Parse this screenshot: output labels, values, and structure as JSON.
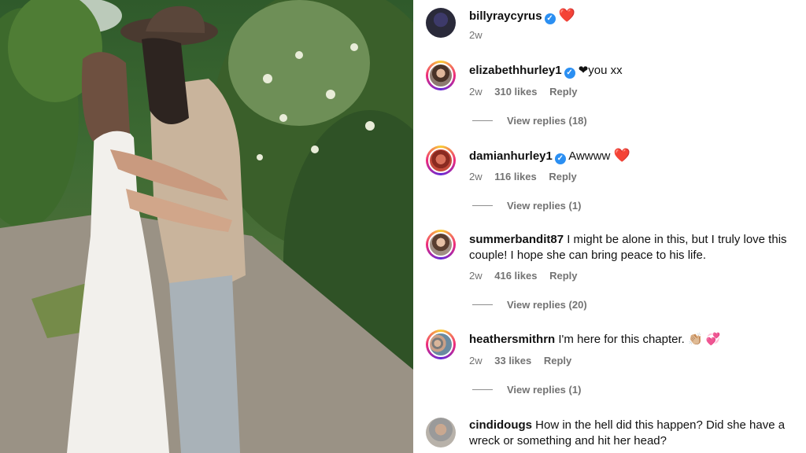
{
  "post": {
    "author": "billyraycyrus",
    "author_verified": true,
    "caption_emoji": "❤️",
    "age": "2w"
  },
  "comments": [
    {
      "username": "elizabethhurley1",
      "verified": true,
      "text": "❤you xx",
      "age": "2w",
      "likes": "310 likes",
      "reply_label": "Reply",
      "view_replies": "View replies (18)"
    },
    {
      "username": "damianhurley1",
      "verified": true,
      "text": "Awwww",
      "text_emoji": "❤️",
      "age": "2w",
      "likes": "116 likes",
      "reply_label": "Reply",
      "view_replies": "View replies (1)"
    },
    {
      "username": "summerbandit87",
      "verified": false,
      "text": "I might be alone in this, but I truly love this couple! I hope she can bring peace to his life.",
      "age": "2w",
      "likes": "416 likes",
      "reply_label": "Reply",
      "view_replies": "View replies (20)"
    },
    {
      "username": "heathersmithrn",
      "verified": false,
      "text": "I'm here for this chapter.",
      "text_emoji": "👏🏼 💞",
      "age": "2w",
      "likes": "33 likes",
      "reply_label": "Reply",
      "view_replies": "View replies (1)"
    },
    {
      "username": "cindidougs",
      "verified": false,
      "text": "How in the hell did this happen? Did she have a wreck or something and hit her head?"
    }
  ],
  "icons": {
    "verified": "verified-badge-icon",
    "heart": "red-heart-icon"
  }
}
